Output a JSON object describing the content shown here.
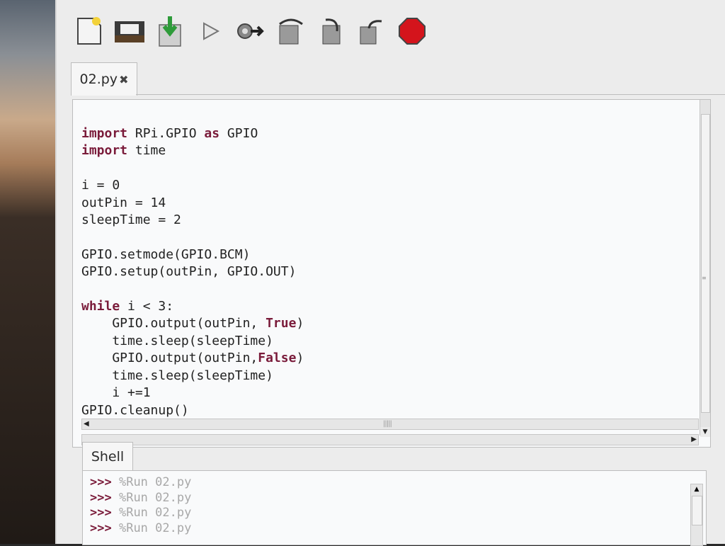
{
  "toolbar": {
    "buttons": [
      {
        "name": "new-file-icon"
      },
      {
        "name": "open-folder-icon"
      },
      {
        "name": "save-icon"
      },
      {
        "name": "run-icon"
      },
      {
        "name": "debug-icon"
      },
      {
        "name": "step-over-icon"
      },
      {
        "name": "step-into-icon"
      },
      {
        "name": "step-out-icon"
      },
      {
        "name": "stop-icon"
      }
    ],
    "stop_color": "#d4141c"
  },
  "editor": {
    "tab_label": "02.py",
    "tab_close": "✖",
    "code": {
      "l1_kw": "import",
      "l1_rest": " RPi.GPIO ",
      "l1_kw2": "as",
      "l1_rest2": " GPIO",
      "l2_kw": "import",
      "l2_rest": " time",
      "l4": "i = 0",
      "l5": "outPin = 14",
      "l6": "sleepTime = 2",
      "l8": "GPIO.setmode(GPIO.BCM)",
      "l9": "GPIO.setup(outPin, GPIO.OUT)",
      "l11_kw": "while",
      "l11_rest": " i < 3:",
      "l12_a": "    GPIO.output(outPin, ",
      "l12_kw": "True",
      "l12_b": ")",
      "l13": "    time.sleep(sleepTime)",
      "l14_a": "    GPIO.output(outPin,",
      "l14_kw": "False",
      "l14_b": ")",
      "l15": "    time.sleep(sleepTime)",
      "l16": "    i +=1",
      "l17": "GPIO.cleanup()"
    }
  },
  "shell": {
    "tab_label": "Shell",
    "lines": [
      {
        "prompt": ">>>",
        "cmd": "%Run 02.py"
      },
      {
        "prompt": ">>>",
        "cmd": "%Run 02.py"
      },
      {
        "prompt": ">>>",
        "cmd": "%Run 02.py"
      },
      {
        "prompt": ">>>",
        "cmd": "%Run 02.py"
      }
    ]
  }
}
